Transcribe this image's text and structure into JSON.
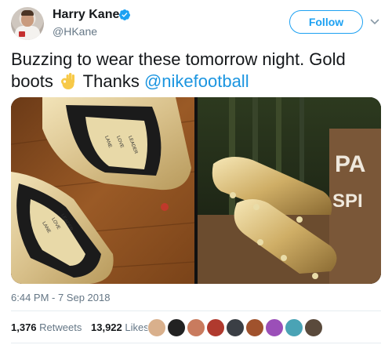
{
  "author": {
    "name": "Harry Kane",
    "handle": "@HKane",
    "verified": true
  },
  "follow_button": {
    "label": "Follow"
  },
  "tweet": {
    "text_part1": "Buzzing to wear these tomorrow night. Gold boots",
    "text_part2": "Thanks",
    "mention": "@nikefootball",
    "emoji": "ok-hand",
    "timestamp": "6:44 PM - 7 Sep 2018"
  },
  "media": {
    "left_photo_insole_text": [
      "LANE",
      "LOVE",
      "LEADER"
    ],
    "right_photo_sign_text": [
      "PA",
      "SPI"
    ]
  },
  "stats": {
    "retweets_count": "1,376",
    "retweets_label": "Retweets",
    "likes_count": "13,922",
    "likes_label": "Likes"
  },
  "colors": {
    "accent": "#1da1f2",
    "mention": "#1b95e0",
    "secondary_text": "#657786"
  }
}
